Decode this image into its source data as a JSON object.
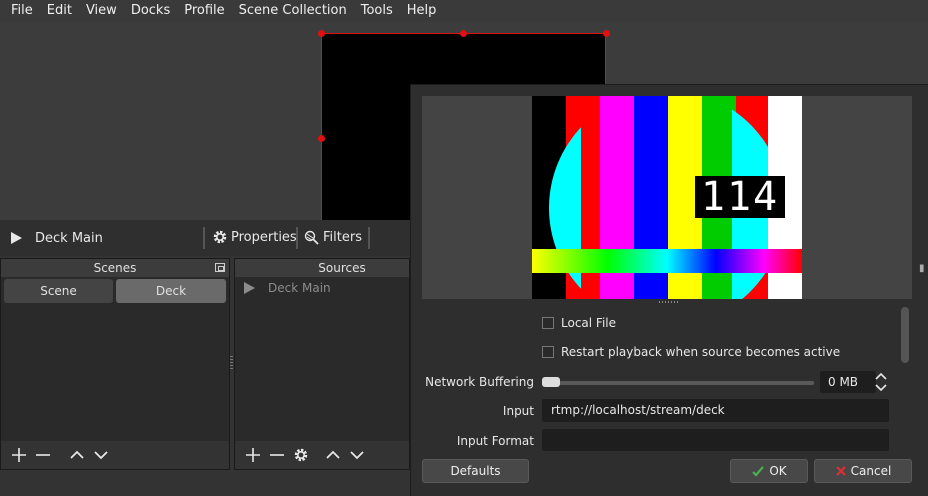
{
  "menubar": {
    "items": [
      "File",
      "Edit",
      "View",
      "Docks",
      "Profile",
      "Scene Collection",
      "Tools",
      "Help"
    ]
  },
  "context_bar": {
    "source_name": "Deck Main",
    "properties_label": "Properties",
    "filters_label": "Filters"
  },
  "scenes_dock": {
    "title": "Scenes",
    "scenes": [
      "Scene",
      "Deck"
    ],
    "selected": "Deck"
  },
  "sources_dock": {
    "title": "Sources",
    "items": [
      "Deck Main"
    ]
  },
  "properties_dialog": {
    "preview_clock": "114",
    "local_file_label": "Local File",
    "restart_label": "Restart playback when source becomes active",
    "network_buffering_label": "Network Buffering",
    "network_buffering_value": "0 MB",
    "input_label": "Input",
    "input_value": "rtmp://localhost/stream/deck",
    "input_format_label": "Input Format",
    "input_format_value": "",
    "defaults_label": "Defaults",
    "ok_label": "OK",
    "cancel_label": "Cancel"
  },
  "colors": {
    "selection_red": "#e01010",
    "accent_green": "#4caf50",
    "cancel_red": "#e03030"
  }
}
